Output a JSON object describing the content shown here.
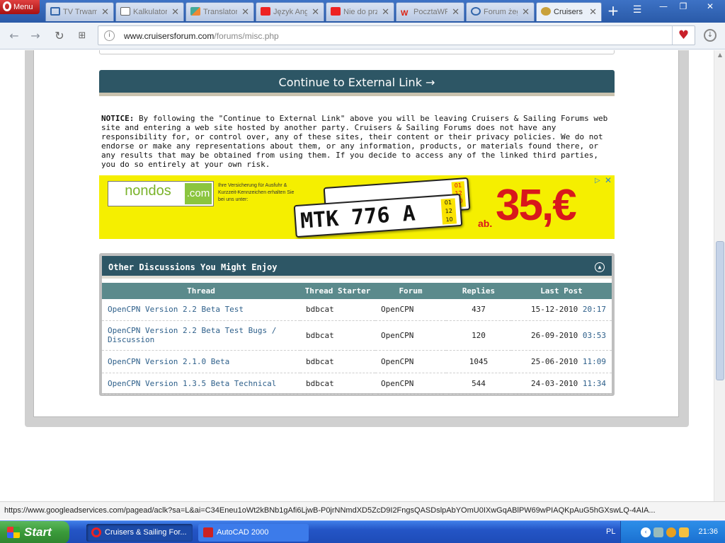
{
  "browser": {
    "menu_label": "Menu",
    "tabs": [
      {
        "label": "TV Trwam",
        "icon": "tv-icon"
      },
      {
        "label": "Kalkulator",
        "icon": "document-icon"
      },
      {
        "label": "Translator",
        "icon": "translate-icon"
      },
      {
        "label": "Język Angielski",
        "icon": "youtube-icon"
      },
      {
        "label": "Nie do przeczytania",
        "icon": "youtube-icon"
      },
      {
        "label": "PocztaWP",
        "icon": "wp-icon"
      },
      {
        "label": "Forum żeglarskie",
        "icon": "forum-icon"
      },
      {
        "label": "Cruisers & Sailing",
        "icon": "cruisers-icon",
        "active": true
      }
    ],
    "url_host": "www.cruisersforum.com",
    "url_path": "/forums/misc.php"
  },
  "page": {
    "continue_label": "Continue to External Link →",
    "notice_label": "NOTICE:",
    "notice_text": "By following the \"Continue to External Link\" above you will be leaving Cruisers & Sailing Forums web site and entering a web site hosted by another party. Cruisers & Sailing Forums does not have any responsibility for, or control over, any of these sites, their content or their privacy policies. We do not endorse or make any representations about them, or any information, products, or materials found there, or any results that may be obtained from using them. If you decide to access any of the linked third parties, you do so entirely at your own risk."
  },
  "ad": {
    "brand": "nondos",
    "brand_tld": ".com",
    "tagline": "Ihre Versicherung für Ausfuhr & Kurzzeit-Kennzeichen erhalten Sie bei uns unter:",
    "plate_text": "MTK 776 A",
    "plate_months": [
      "01",
      "12",
      "10"
    ],
    "plate_back_months": [
      "01",
      "12",
      "10"
    ],
    "price_prefix": "ab.",
    "price": "35,€",
    "colors": {
      "background": "#f5ef00",
      "price": "#d8181c"
    }
  },
  "discussions": {
    "title": "Other Discussions You Might Enjoy",
    "columns": [
      "Thread",
      "Thread Starter",
      "Forum",
      "Replies",
      "Last Post"
    ],
    "rows": [
      {
        "thread": "OpenCPN Version 2.2 Beta Test",
        "starter": "bdbcat",
        "forum": "OpenCPN",
        "replies": "437",
        "date": "15-12-2010",
        "time": "20:17"
      },
      {
        "thread": "OpenCPN Version 2.2 Beta Test Bugs / Discussion",
        "starter": "bdbcat",
        "forum": "OpenCPN",
        "replies": "120",
        "date": "26-09-2010",
        "time": "03:53"
      },
      {
        "thread": "OpenCPN Version 2.1.0 Beta",
        "starter": "bdbcat",
        "forum": "OpenCPN",
        "replies": "1045",
        "date": "25-06-2010",
        "time": "11:09"
      },
      {
        "thread": "OpenCPN Version 1.3.5 Beta Technical",
        "starter": "bdbcat",
        "forum": "OpenCPN",
        "replies": "544",
        "date": "24-03-2010",
        "time": "11:34"
      }
    ]
  },
  "status_url": "https://www.googleadservices.com/pagead/aclk?sa=L&ai=C34Eneu1oWt2kBNb1gAfi6LjwB-P0jrNNmdXD5ZcD9I2FngsQASDslpAbYOmU0IXwGqABlPW69wPIAQKpAuG5hGXswLQ-4AIA...",
  "taskbar": {
    "start_label": "Start",
    "items": [
      {
        "label": "Cruisers & Sailing For...",
        "icon": "opera-icon"
      },
      {
        "label": "AutoCAD 2000",
        "icon": "autocad-icon"
      }
    ],
    "language": "PL",
    "clock": "21:36"
  },
  "theme": {
    "accent": "#2d5665",
    "header_row": "#5b8a8c",
    "link": "#2d5f8a"
  }
}
